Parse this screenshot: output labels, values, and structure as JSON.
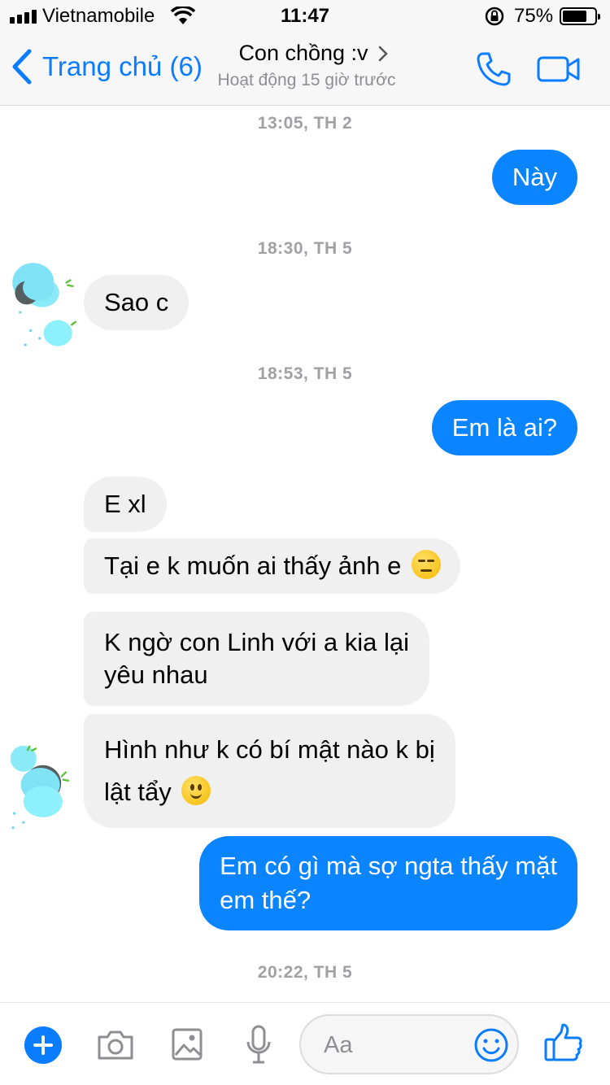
{
  "status_bar": {
    "carrier": "Vietnamobile",
    "time": "11:47",
    "battery": "75%",
    "battery_level": 0.75
  },
  "nav": {
    "back_label": "Trang chủ (6)",
    "contact_name": "Con chồng :v",
    "active_status": "Hoạt động 15 giờ trước"
  },
  "messages": {
    "ts1": "13:05, TH 2",
    "m1": "Này",
    "ts2": "18:30, TH 5",
    "m2": "Sao c",
    "ts3": "18:53, TH 5",
    "m3": "Em là ai?",
    "m4": "E xl",
    "m5": "Tại e k muốn ai thấy ảnh e",
    "m5_emoji": "expressionless-face",
    "m6_line1": "K ngờ con Linh với a kia lại",
    "m6_line2": "yêu nhau",
    "m7_line1": "Hình như k có bí mật nào k bị",
    "m7_line2": "lật tẩy",
    "m7_emoji": "slightly-smiling-face",
    "m8_line1": "Em có gì mà sợ ngta thấy mặt",
    "m8_line2": "em thế?",
    "ts4": "20:22, TH 5"
  },
  "compose": {
    "placeholder": "Aa"
  },
  "colors": {
    "accent": "#0a7cff",
    "outgoing_bubble": "#0a84ff",
    "incoming_bubble": "#f0f0f0"
  }
}
